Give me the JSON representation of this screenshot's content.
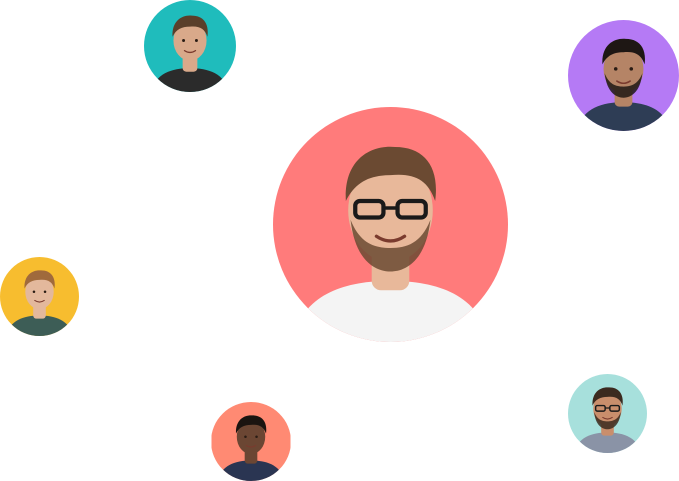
{
  "avatars": [
    {
      "id": "main",
      "bg": "#ff7b7b",
      "skin": "#e8b89a",
      "hair": "#6b4a32",
      "shirt": "#f4f4f4",
      "beard": true,
      "glasses": true
    },
    {
      "id": "teal",
      "bg": "#1fbcbc",
      "skin": "#d9a98a",
      "hair": "#5a3f2a",
      "shirt": "#2b2b2b",
      "beard": false,
      "glasses": false
    },
    {
      "id": "purple",
      "bg": "#b57af5",
      "skin": "#b58466",
      "hair": "#1e1714",
      "shirt": "#2e3d55",
      "beard": true,
      "glasses": false
    },
    {
      "id": "yellow",
      "bg": "#f7bd2f",
      "skin": "#e3b89c",
      "hair": "#a06a3c",
      "shirt": "#3d5d56",
      "beard": false,
      "glasses": false
    },
    {
      "id": "coral",
      "bg": "#ff8a73",
      "skin": "#6b4633",
      "hair": "#1b1410",
      "shirt": "#2a3552",
      "beard": false,
      "glasses": false
    },
    {
      "id": "mint",
      "bg": "#a7e0dc",
      "skin": "#c98e6c",
      "hair": "#3b2a1f",
      "shirt": "#8a93a6",
      "beard": true,
      "glasses": true
    }
  ]
}
